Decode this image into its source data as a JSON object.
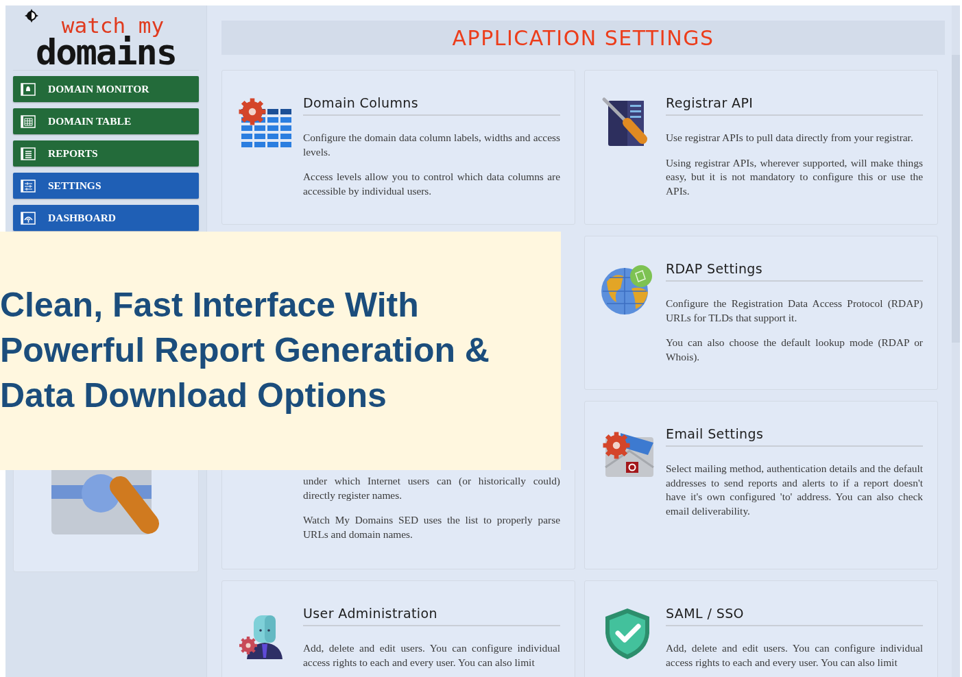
{
  "logo": {
    "top": "watch my",
    "bottom": "domains"
  },
  "nav": [
    {
      "label": "DOMAIN MONITOR",
      "color": "#236b3a"
    },
    {
      "label": "DOMAIN TABLE",
      "color": "#236b3a"
    },
    {
      "label": "REPORTS",
      "color": "#236b3a"
    },
    {
      "label": "SETTINGS",
      "color": "#1f5fb5"
    },
    {
      "label": "DASHBOARD",
      "color": "#1f5fb5"
    }
  ],
  "header": {
    "title": "APPLICATION SETTINGS"
  },
  "columns": [
    [
      {
        "kind": "full",
        "title": "Domain Columns",
        "paragraphs": [
          "Configure the domain data column labels, widths and access levels.",
          "Access levels allow you to control which data columns are accessible by individual users."
        ]
      },
      {
        "kind": "partial",
        "paragraphs": [
          "under which Internet users can (or historically could) directly register names.",
          "Watch My Domains SED uses the list to properly parse URLs and domain names."
        ]
      },
      {
        "kind": "full",
        "title": "User Administration",
        "paragraphs": [
          "Add, delete and edit users. You can configure individual access rights to each and every user. You can also limit"
        ]
      }
    ],
    [
      {
        "kind": "full",
        "title": "Registrar API",
        "paragraphs": [
          "Use registrar APIs to pull data directly from your registrar.",
          "Using registrar APIs, wherever supported, will make things easy, but it is not mandatory to configure this or use the APIs."
        ]
      },
      {
        "kind": "full",
        "title": "RDAP Settings",
        "paragraphs": [
          "Configure the Registration Data Access Protocol (RDAP) URLs for TLDs that support it.",
          "You can also choose the default lookup mode (RDAP or Whois)."
        ]
      },
      {
        "kind": "full",
        "title": "Email Settings",
        "paragraphs": [
          "Select mailing method, authentication details and the default addresses to send reports and alerts to if a report doesn't have it's own configured 'to' address. You can also check email deliverability."
        ]
      },
      {
        "kind": "full",
        "title": "SAML / SSO",
        "paragraphs": [
          "Add, delete and edit users. You can configure individual access rights to each and every user. You can also limit"
        ]
      }
    ]
  ],
  "banner": {
    "text": "Clean, Fast Interface With Powerful Report Generation & Data Download Options"
  }
}
